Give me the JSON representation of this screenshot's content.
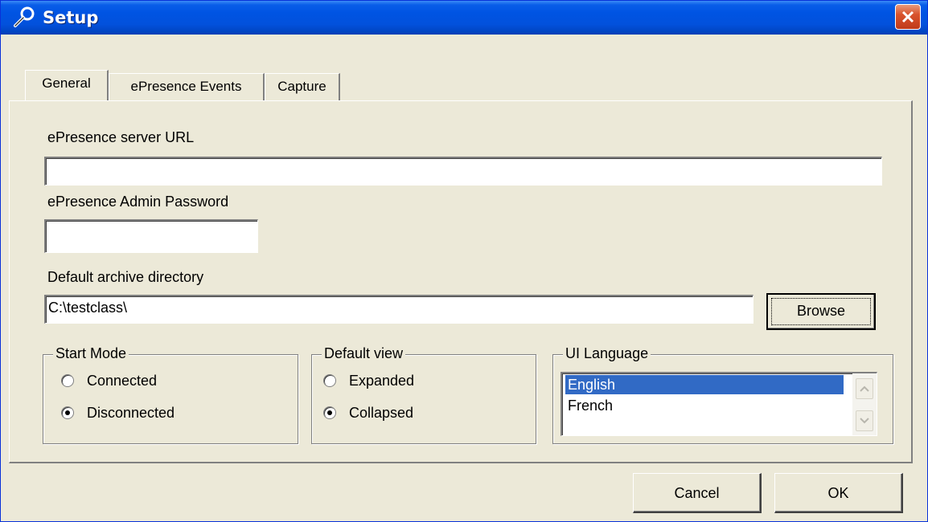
{
  "window": {
    "title": "Setup"
  },
  "tabs": [
    {
      "label": "General",
      "active": true
    },
    {
      "label": "ePresence Events",
      "active": false
    },
    {
      "label": "Capture",
      "active": false
    }
  ],
  "general": {
    "server_url_label": "ePresence server URL",
    "server_url_value": "",
    "admin_password_label": "ePresence Admin Password",
    "admin_password_value": "",
    "archive_dir_label": "Default archive directory",
    "archive_dir_value": "C:\\testclass\\",
    "browse_label": "Browse"
  },
  "start_mode": {
    "title": "Start Mode",
    "options": [
      {
        "label": "Connected",
        "selected": false
      },
      {
        "label": "Disconnected",
        "selected": true
      }
    ]
  },
  "default_view": {
    "title": "Default view",
    "options": [
      {
        "label": "Expanded",
        "selected": false
      },
      {
        "label": "Collapsed",
        "selected": true
      }
    ]
  },
  "ui_language": {
    "title": "UI Language",
    "items": [
      {
        "label": "English",
        "selected": true
      },
      {
        "label": "French",
        "selected": false
      }
    ]
  },
  "footer": {
    "cancel_label": "Cancel",
    "ok_label": "OK"
  },
  "colors": {
    "titlebar": "#0054e3",
    "selection": "#316ac5",
    "close": "#d9532d",
    "face": "#ece9d8"
  }
}
